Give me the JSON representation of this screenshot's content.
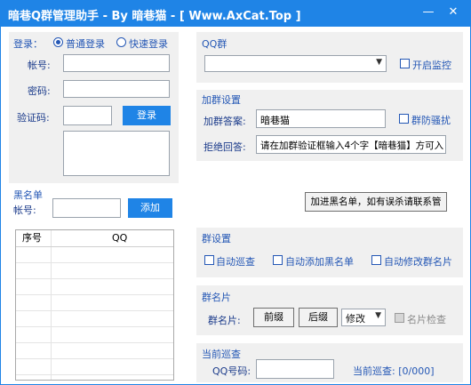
{
  "window": {
    "title": "暗巷Q群管理助手  - By 暗巷猫 - [ Www.AxCat.Top ]",
    "minimize_glyph": "—",
    "close_glyph": "✕"
  },
  "login": {
    "label": "登录：",
    "mode_normal": "普通登录",
    "mode_quick": "快速登录",
    "account_label": "帐号:",
    "password_label": "密码:",
    "captcha_label": "验证码:",
    "login_button": "登录"
  },
  "qq_group": {
    "title": "QQ群",
    "selected": "",
    "monitor_label": "开启监控"
  },
  "add_group": {
    "title": "加群设置",
    "answer_label": "加群答案:",
    "answer_value": "暗巷猫",
    "anti_harass_label": "群防骚扰",
    "reject_label": "拒绝回答:",
    "reject_value": "请在加群验证框输入4个字【暗巷猫】方可入"
  },
  "blacklist": {
    "title": "黑名单",
    "account_label": "帐号:",
    "add_button": "添加",
    "notice_button": "加进黑名单，如有误杀请联系管",
    "columns": [
      "序号",
      "QQ"
    ]
  },
  "group_settings": {
    "title": "群设置",
    "auto_patrol": "自动巡查",
    "auto_blacklist": "自动添加黑名单",
    "auto_rename": "自动修改群名片"
  },
  "group_card": {
    "title": "群名片",
    "label": "群名片:",
    "prefix_button": "前缀",
    "suffix_button": "后缀",
    "mode_selected": "修改",
    "check_label": "名片检查"
  },
  "patrol": {
    "title": "当前巡查",
    "qq_label": "QQ号码:",
    "current_label": "当前巡查: [0/000]"
  }
}
